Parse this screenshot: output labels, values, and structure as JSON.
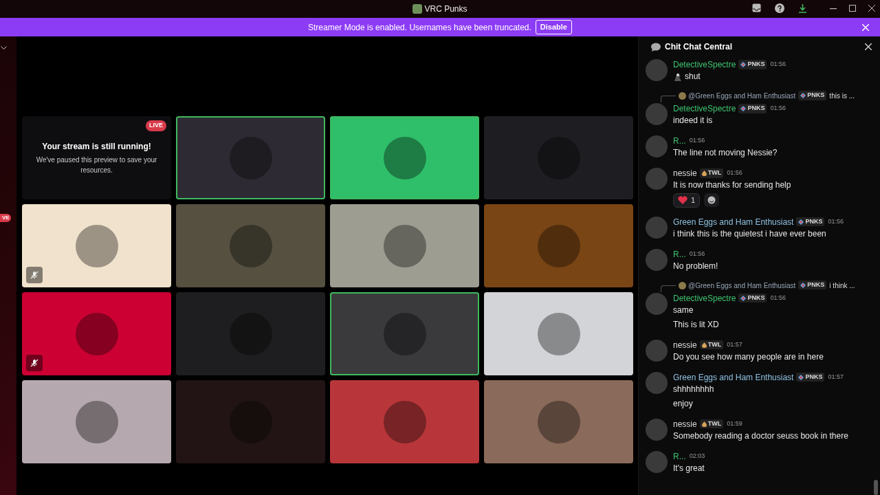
{
  "window": {
    "title": "VRC Punks"
  },
  "banner": {
    "text": "Streamer Mode is enabled. Usernames have been truncated.",
    "button": "Disable"
  },
  "sidebar": {
    "live_badge": "VE"
  },
  "stream_tile": {
    "badge": "LIVE",
    "title": "Your stream is still running!",
    "text": "We've paused this preview to save your resources."
  },
  "tiles": [
    {
      "color": "#2e2a33",
      "speaking": true,
      "muted": false
    },
    {
      "color": "#2fbf6a",
      "speaking": true,
      "muted": false
    },
    {
      "color": "#1e1e22",
      "speaking": false,
      "muted": false
    },
    {
      "color": "#f0e2cc",
      "speaking": false,
      "muted": true
    },
    {
      "color": "#55503f",
      "speaking": false,
      "muted": false
    },
    {
      "color": "#9d9d92",
      "speaking": false,
      "muted": false
    },
    {
      "color": "#7a4515",
      "speaking": false,
      "muted": false
    },
    {
      "color": "#cc0033",
      "speaking": false,
      "muted": true
    },
    {
      "color": "#1e1e20",
      "speaking": false,
      "muted": false
    },
    {
      "color": "#3a3a3c",
      "speaking": true,
      "muted": false
    },
    {
      "color": "#d3d4d8",
      "speaking": false,
      "muted": false
    },
    {
      "color": "#b5a8ae",
      "speaking": false,
      "muted": false
    },
    {
      "color": "#221414",
      "speaking": false,
      "muted": false
    },
    {
      "color": "#b8363a",
      "speaking": false,
      "muted": false
    },
    {
      "color": "#8a6a5a",
      "speaking": false,
      "muted": false
    }
  ],
  "chat": {
    "title": "Chit Chat Central",
    "messages": [
      {
        "author": "DetectiveSpectre",
        "color": "#3ec46d",
        "tag": {
          "kind": "diamond",
          "text": "PNKS"
        },
        "time": "01:56",
        "emoji": true,
        "lines": [
          "shut"
        ]
      },
      {
        "reply": {
          "author": "@Green Eggs and Ham Enthusiast",
          "tag": {
            "kind": "diamond",
            "text": "PNKS"
          },
          "text": "this is ..."
        },
        "author": "DetectiveSpectre",
        "color": "#3ec46d",
        "tag": {
          "kind": "diamond",
          "text": "PNKS"
        },
        "time": "01:56",
        "lines": [
          "indeed it is"
        ]
      },
      {
        "author": "R...",
        "color": "#3ec46d",
        "time": "01:56",
        "lines": [
          "The line not moving Nessie?"
        ]
      },
      {
        "author": "nessie",
        "color": "#dcdcdc",
        "tag": {
          "kind": "flame",
          "text": "TWL"
        },
        "time": "01:56",
        "lines": [
          "It is now thanks for sending help"
        ],
        "reactions": [
          {
            "count": "1"
          }
        ]
      },
      {
        "author": "Green Eggs and Ham Enthusiast",
        "color": "#8fc1e0",
        "tag": {
          "kind": "diamond",
          "text": "PNKS"
        },
        "time": "01:56",
        "lines": [
          "i think this is the quietest i have ever been"
        ]
      },
      {
        "author": "R...",
        "color": "#3ec46d",
        "time": "01:56",
        "lines": [
          "No problem!"
        ]
      },
      {
        "reply": {
          "author": "@Green Eggs and Ham Enthusiast",
          "tag": {
            "kind": "diamond",
            "text": "PNKS"
          },
          "text": "i think ..."
        },
        "author": "DetectiveSpectre",
        "color": "#3ec46d",
        "tag": {
          "kind": "diamond",
          "text": "PNKS"
        },
        "time": "01:56",
        "lines": [
          "same",
          "This is lit XD"
        ]
      },
      {
        "author": "nessie",
        "color": "#dcdcdc",
        "tag": {
          "kind": "flame",
          "text": "TWL"
        },
        "time": "01:57",
        "lines": [
          "Do you see how many people are in here"
        ]
      },
      {
        "author": "Green Eggs and Ham Enthusiast",
        "color": "#8fc1e0",
        "tag": {
          "kind": "diamond",
          "text": "PNKS"
        },
        "time": "01:57",
        "lines": [
          "shhhhhhhh",
          "enjoy"
        ]
      },
      {
        "author": "nessie",
        "color": "#dcdcdc",
        "tag": {
          "kind": "flame",
          "text": "TWL"
        },
        "time": "01:59",
        "lines": [
          "Somebody reading a doctor seuss book in there"
        ]
      },
      {
        "author": "R...",
        "color": "#3ec46d",
        "time": "02:03",
        "lines": [
          "It's great"
        ]
      }
    ]
  }
}
